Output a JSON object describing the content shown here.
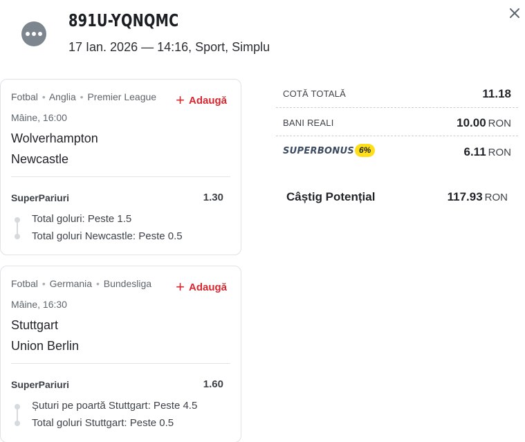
{
  "ticket": {
    "id": "891U-YQNQMC",
    "meta": "17 Ian. 2026 — 14:16, Sport, Simplu"
  },
  "icons": {
    "more": "more-dots-icon",
    "close": "close-icon",
    "add": "plus-icon"
  },
  "colors": {
    "accent": "#d7262e",
    "badge": "#ffde1a",
    "icon_bg": "#7d868e"
  },
  "bets": [
    {
      "sport": "Fotbal",
      "country": "Anglia",
      "league": "Premier League",
      "add_label": "Adaugă",
      "time": "Mâine, 16:00",
      "home": "Wolverhampton",
      "away": "Newcastle",
      "market": "SuperPariuri",
      "odd": "1.30",
      "selections": [
        "Total goluri: Peste 1.5",
        "Total goluri Newcastle: Peste 0.5"
      ]
    },
    {
      "sport": "Fotbal",
      "country": "Germania",
      "league": "Bundesliga",
      "add_label": "Adaugă",
      "time": "Mâine, 16:30",
      "home": "Stuttgart",
      "away": "Union Berlin",
      "market": "SuperPariuri",
      "odd": "1.60",
      "selections": [
        "Șuturi pe poartă Stuttgart: Peste 4.5",
        "Total goluri Stuttgart: Peste 0.5"
      ]
    }
  ],
  "summary": {
    "total_odds_label": "Cotă totală",
    "total_odds": "11.18",
    "real_money_label": "Bani reali",
    "real_money": "10.00",
    "currency": "RON",
    "superbonus_label": "SUPERBONUS",
    "superbonus_pct": "6%",
    "superbonus_value": "6.11",
    "potential_label": "Câștig Potențial",
    "potential_value": "117.93"
  }
}
